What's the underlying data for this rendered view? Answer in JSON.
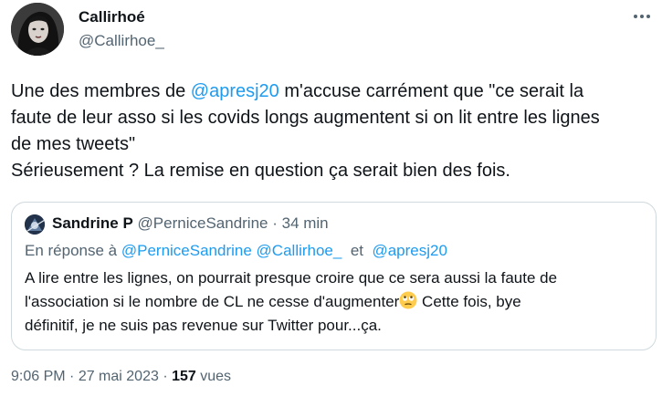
{
  "author": {
    "name": "Callirhoé",
    "handle": "@Callirhoe_"
  },
  "tweet": {
    "line1_prefix": "Une des membres de ",
    "line1_mention": "@apresj20",
    "line1_suffix": " m'accuse carrément que \"ce serait la",
    "line2": "faute de leur asso si les covids longs augmentent si on lit entre les lignes",
    "line3": "de mes tweets\"",
    "line4": "Sérieusement ? La remise en question ça serait bien des fois."
  },
  "quote": {
    "name": "Sandrine P",
    "handle": "@PerniceSandrine",
    "separator": " · ",
    "time": "34 min",
    "reply_prefix": "En réponse à ",
    "reply_mention1": "@PerniceSandrine",
    "reply_mention2": "@Callirhoe_",
    "reply_and": "et",
    "reply_mention3": "@apresj20",
    "text_line1": "A lire entre les lignes, on pourrait presque croire que ce sera aussi la faute de",
    "text_line2_a": "l'association si le nombre de CL ne cesse d'augmenter",
    "text_line2_b": " Cette fois, bye",
    "text_line3": "définitif, je ne suis pas revenue sur Twitter pour...ça.",
    "emoji": "face-with-rolling-eyes"
  },
  "meta": {
    "time": "9:06 PM",
    "date": "27 mai 2023",
    "separator": " · ",
    "views_count": "157",
    "views_label": "vues"
  },
  "colors": {
    "text": "#0f1419",
    "secondary": "#536471",
    "link": "#1d9bf0",
    "border": "#cfd9de"
  }
}
